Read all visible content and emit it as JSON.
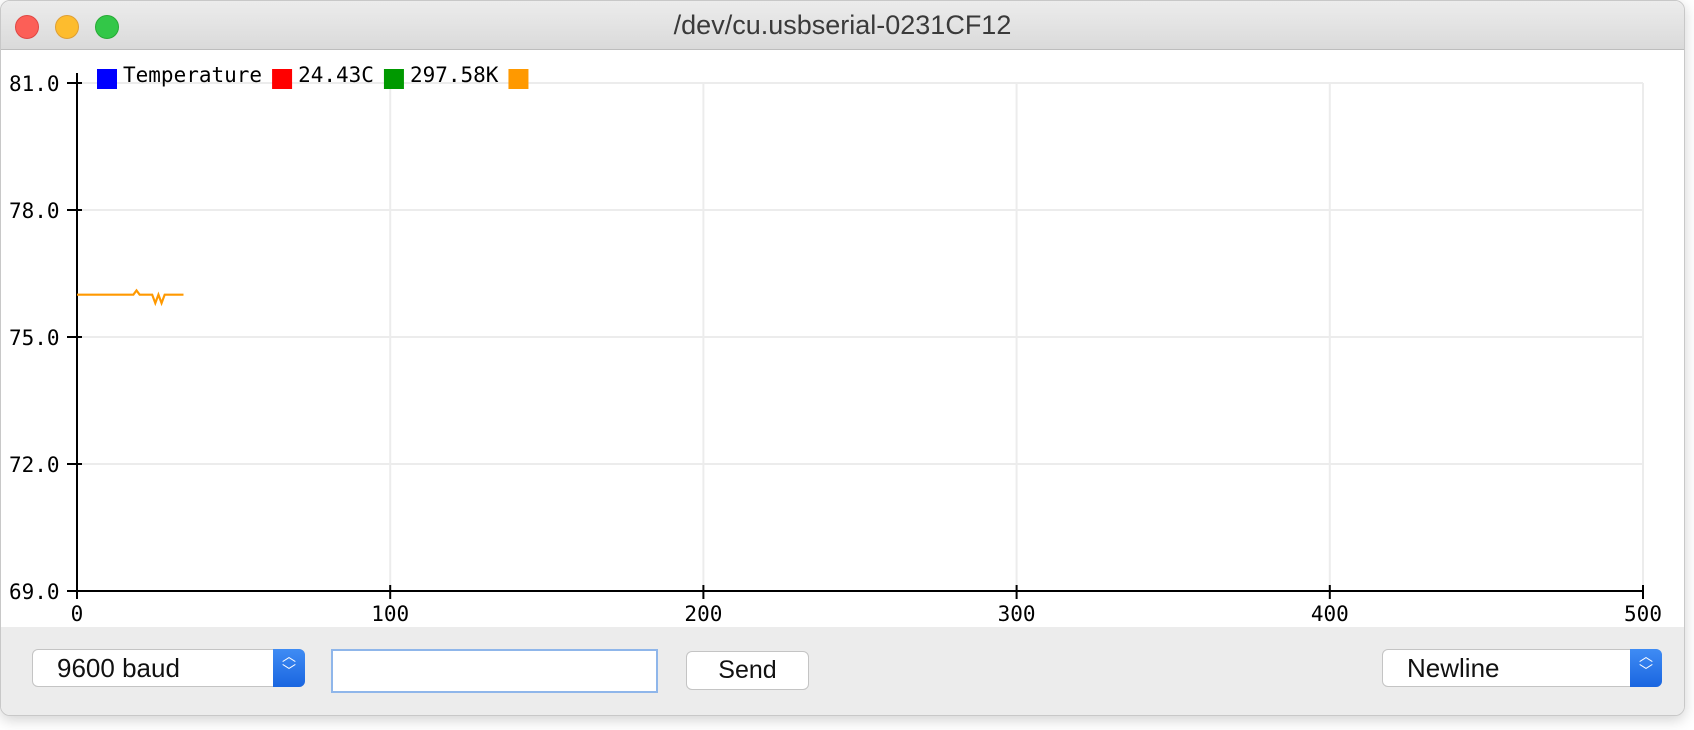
{
  "window": {
    "title": "/dev/cu.usbserial-0231CF12"
  },
  "legend": [
    {
      "label": "Temperature",
      "color": "#0000ff"
    },
    {
      "label": "24.43C",
      "color": "#ff0000"
    },
    {
      "label": "297.58K",
      "color": "#009900"
    },
    {
      "label": "",
      "color": "#ff9900"
    }
  ],
  "chart_data": {
    "type": "line",
    "xlim": [
      0,
      500
    ],
    "ylim": [
      69.0,
      81.0
    ],
    "xticks": [
      "0",
      "100",
      "200",
      "300",
      "400",
      "500"
    ],
    "yticks": [
      "69.0",
      "72.0",
      "75.0",
      "78.0",
      "81.0"
    ],
    "grid": true,
    "legend_position": "top-left",
    "series": [
      {
        "color": "#ff9900",
        "x": [
          0,
          5,
          10,
          15,
          17,
          18,
          19,
          20,
          22,
          24,
          25,
          26,
          27,
          28,
          30,
          32,
          34
        ],
        "y": [
          76.0,
          76.0,
          76.0,
          76.0,
          76.0,
          76.0,
          76.1,
          76.0,
          76.0,
          76.0,
          75.8,
          76.0,
          75.8,
          76.0,
          76.0,
          76.0,
          76.0
        ]
      }
    ]
  },
  "controls": {
    "baud_label": "9600 baud",
    "send_input_value": "",
    "send_label": "Send",
    "line_ending_label": "Newline"
  }
}
